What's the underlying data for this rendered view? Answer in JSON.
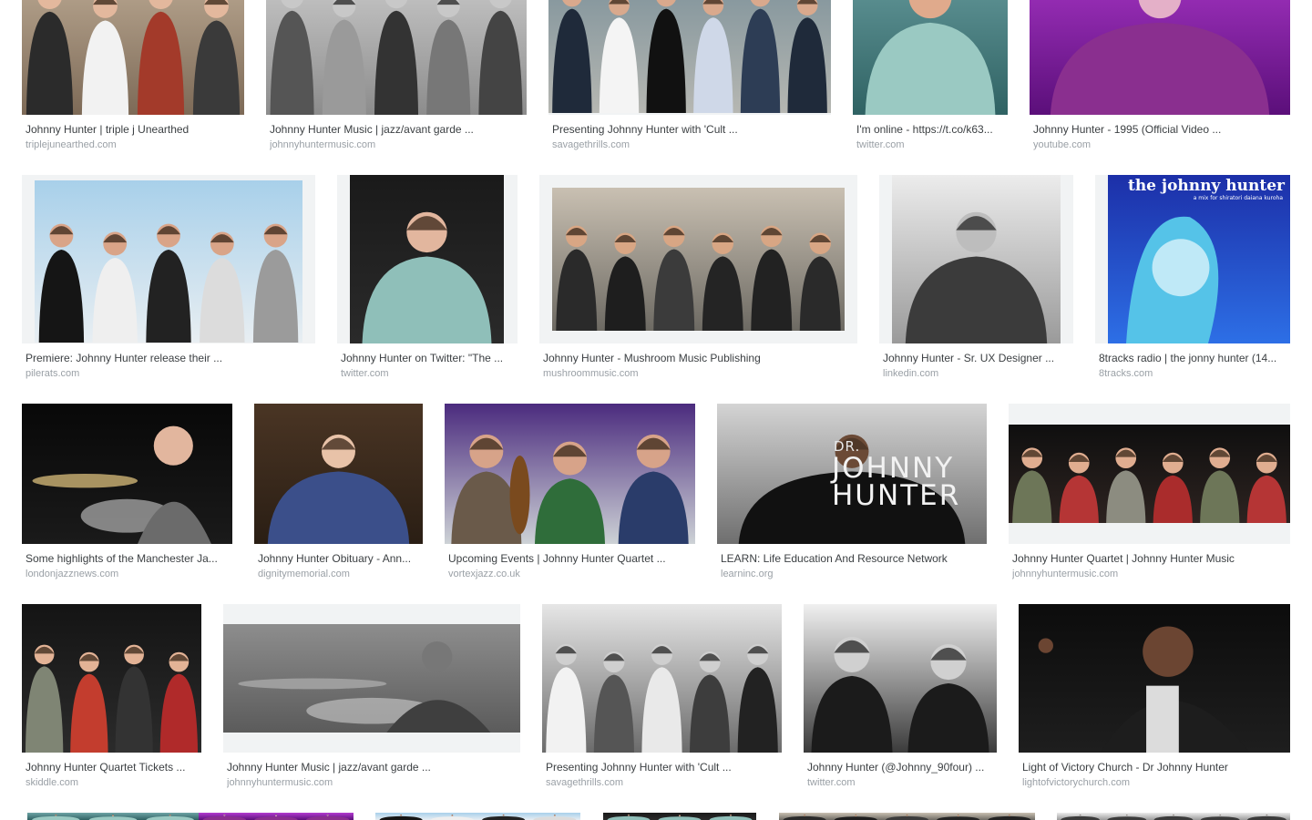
{
  "results": [
    {
      "title": "Johnny Hunter | triple j Unearthed",
      "source": "triplejunearthed.com",
      "thumb": "band-photo"
    },
    {
      "title": "Johnny Hunter Music | jazz/avant garde ...",
      "source": "johnnyhuntermusic.com",
      "thumb": "band-photo-grayscale"
    },
    {
      "title": "Presenting Johnny Hunter with 'Cult ...",
      "source": "savagethrills.com",
      "thumb": "band-photo"
    },
    {
      "title": "I'm online - https://t.co/k63...",
      "source": "twitter.com",
      "thumb": "portrait-photo"
    },
    {
      "title": "Johnny Hunter - 1995 (Official Video ...",
      "source": "youtube.com",
      "thumb": "video-still"
    },
    {
      "title": "Premiere: Johnny Hunter release their ...",
      "source": "pilerats.com",
      "thumb": "band-photo"
    },
    {
      "title": "Johnny Hunter on Twitter: \"The ...",
      "source": "twitter.com",
      "thumb": "portrait-photo"
    },
    {
      "title": "Johnny Hunter - Mushroom Music Publishing",
      "source": "mushroommusic.com",
      "thumb": "band-photo"
    },
    {
      "title": "Johnny Hunter - Sr. UX Designer ...",
      "source": "linkedin.com",
      "thumb": "portrait-photo-grayscale"
    },
    {
      "title": "8tracks radio | the jonny hunter (14...",
      "source": "8tracks.com",
      "thumb": "illustration",
      "overlay_title": "the johnny hunter",
      "overlay_subtitle": "a mix for shiratori daiana kuroha"
    },
    {
      "title": "Some highlights of the Manchester Ja...",
      "source": "londonjazznews.com",
      "thumb": "drummer-photo"
    },
    {
      "title": "Johnny Hunter Obituary - Ann...",
      "source": "dignitymemorial.com",
      "thumb": "portrait-photo"
    },
    {
      "title": "Upcoming Events | Johnny Hunter Quartet ...",
      "source": "vortexjazz.co.uk",
      "thumb": "concert-photo"
    },
    {
      "title": "LEARN: Life Education And Resource Network",
      "source": "learninc.org",
      "thumb": "portrait-photo",
      "overlay_dr": "DR.",
      "overlay_line1": "JOHNNY",
      "overlay_line2": "HUNTER"
    },
    {
      "title": "Johnny Hunter Quartet | Johnny Hunter Music",
      "source": "johnnyhuntermusic.com",
      "thumb": "band-photo"
    },
    {
      "title": "Johnny Hunter Quartet Tickets ...",
      "source": "skiddle.com",
      "thumb": "band-photo"
    },
    {
      "title": "Johnny Hunter Music | jazz/avant garde ...",
      "source": "johnnyhuntermusic.com",
      "thumb": "drummer-photo-grayscale"
    },
    {
      "title": "Presenting Johnny Hunter with 'Cult ...",
      "source": "savagethrills.com",
      "thumb": "band-photo-grayscale"
    },
    {
      "title": "Johnny Hunter (@Johnny_90four) ...",
      "source": "twitter.com",
      "thumb": "couple-photo-grayscale"
    },
    {
      "title": "Light of Victory Church - Dr Johnny Hunter",
      "source": "lightofvictorychurch.com",
      "thumb": "speaker-photo"
    }
  ],
  "colors": {
    "title_text": "#3c4043",
    "source_text": "#9aa0a6",
    "thumb_background": "#f1f3f4"
  }
}
